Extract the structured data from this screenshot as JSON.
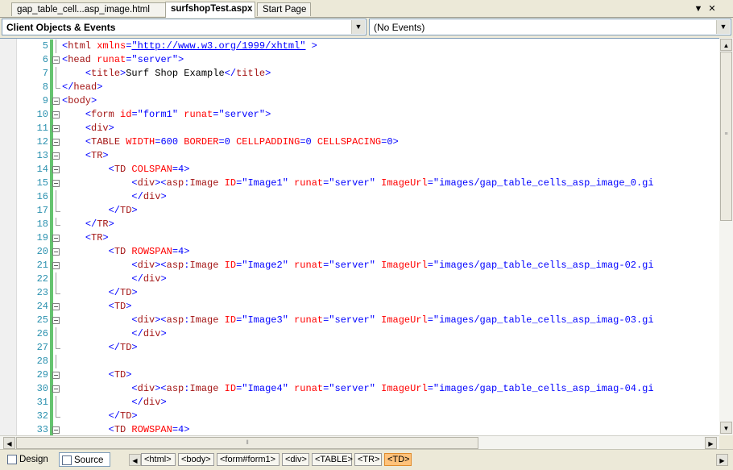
{
  "tabs": [
    {
      "label": "gap_table_cell...asp_image.html",
      "active": false
    },
    {
      "label": "surfshopTest.aspx",
      "active": true
    },
    {
      "label": "Start Page",
      "active": false
    }
  ],
  "tab_controls": {
    "dropdown": "▼",
    "close": "✕"
  },
  "toolbar": {
    "objects_combo": "Client Objects & Events",
    "events_combo": "(No Events)"
  },
  "code_lines": [
    {
      "n": "5",
      "fold": "",
      "tokens": [
        [
          "b",
          "<"
        ],
        [
          "r",
          "html "
        ],
        [
          "a",
          "xmlns"
        ],
        [
          "b",
          "="
        ],
        [
          "u",
          "\"http://www.w3.org/1999/xhtml\""
        ],
        [
          "b",
          " >"
        ]
      ]
    },
    {
      "n": "6",
      "fold": "-",
      "tokens": [
        [
          "b",
          "<"
        ],
        [
          "r",
          "head "
        ],
        [
          "a",
          "runat"
        ],
        [
          "b",
          "=\"server\">"
        ]
      ]
    },
    {
      "n": "7",
      "fold": "",
      "tokens": [
        [
          "x",
          "    "
        ],
        [
          "b",
          "<"
        ],
        [
          "r",
          "title"
        ],
        [
          "b",
          ">"
        ],
        [
          "x",
          "Surf Shop Example"
        ],
        [
          "b",
          "</"
        ],
        [
          "r",
          "title"
        ],
        [
          "b",
          ">"
        ]
      ]
    },
    {
      "n": "8",
      "fold": "e",
      "tokens": [
        [
          "b",
          "</"
        ],
        [
          "r",
          "head"
        ],
        [
          "b",
          ">"
        ]
      ]
    },
    {
      "n": "9",
      "fold": "-",
      "tokens": [
        [
          "b",
          "<"
        ],
        [
          "r",
          "body"
        ],
        [
          "b",
          ">"
        ]
      ]
    },
    {
      "n": "10",
      "fold": "-",
      "tokens": [
        [
          "x",
          "    "
        ],
        [
          "b",
          "<"
        ],
        [
          "r",
          "form "
        ],
        [
          "a",
          "id"
        ],
        [
          "b",
          "=\"form1\" "
        ],
        [
          "a",
          "runat"
        ],
        [
          "b",
          "=\"server\">"
        ]
      ]
    },
    {
      "n": "11",
      "fold": "-",
      "tokens": [
        [
          "x",
          "    "
        ],
        [
          "b",
          "<"
        ],
        [
          "r",
          "div"
        ],
        [
          "b",
          ">"
        ]
      ]
    },
    {
      "n": "12",
      "fold": "-",
      "tokens": [
        [
          "x",
          "    "
        ],
        [
          "b",
          "<"
        ],
        [
          "r",
          "TABLE "
        ],
        [
          "a",
          "WIDTH"
        ],
        [
          "b",
          "=600 "
        ],
        [
          "a",
          "BORDER"
        ],
        [
          "b",
          "=0 "
        ],
        [
          "a",
          "CELLPADDING"
        ],
        [
          "b",
          "=0 "
        ],
        [
          "a",
          "CELLSPACING"
        ],
        [
          "b",
          "=0>"
        ]
      ]
    },
    {
      "n": "13",
      "fold": "-",
      "tokens": [
        [
          "x",
          "    "
        ],
        [
          "b",
          "<"
        ],
        [
          "r",
          "TR"
        ],
        [
          "b",
          ">"
        ]
      ]
    },
    {
      "n": "14",
      "fold": "-",
      "tokens": [
        [
          "x",
          "        "
        ],
        [
          "b",
          "<"
        ],
        [
          "r",
          "TD "
        ],
        [
          "a",
          "COLSPAN"
        ],
        [
          "b",
          "=4>"
        ]
      ]
    },
    {
      "n": "15",
      "fold": "-",
      "tokens": [
        [
          "x",
          "            "
        ],
        [
          "b",
          "<"
        ],
        [
          "r",
          "div"
        ],
        [
          "b",
          "><"
        ],
        [
          "r",
          "asp"
        ],
        [
          "b",
          ":"
        ],
        [
          "r",
          "Image "
        ],
        [
          "a",
          "ID"
        ],
        [
          "b",
          "=\"Image1\" "
        ],
        [
          "a",
          "runat"
        ],
        [
          "b",
          "=\"server\" "
        ],
        [
          "a",
          "ImageUrl"
        ],
        [
          "b",
          "=\"images/gap_table_cells_asp_image_0.gi"
        ]
      ]
    },
    {
      "n": "16",
      "fold": "",
      "tokens": [
        [
          "x",
          "            "
        ],
        [
          "b",
          "</"
        ],
        [
          "r",
          "div"
        ],
        [
          "b",
          ">"
        ]
      ]
    },
    {
      "n": "17",
      "fold": "e",
      "tokens": [
        [
          "x",
          "        "
        ],
        [
          "b",
          "</"
        ],
        [
          "r",
          "TD"
        ],
        [
          "b",
          ">"
        ]
      ]
    },
    {
      "n": "18",
      "fold": "e",
      "tokens": [
        [
          "x",
          "    "
        ],
        [
          "b",
          "</"
        ],
        [
          "r",
          "TR"
        ],
        [
          "b",
          ">"
        ]
      ]
    },
    {
      "n": "19",
      "fold": "-",
      "tokens": [
        [
          "x",
          "    "
        ],
        [
          "b",
          "<"
        ],
        [
          "r",
          "TR"
        ],
        [
          "b",
          ">"
        ]
      ]
    },
    {
      "n": "20",
      "fold": "-",
      "tokens": [
        [
          "x",
          "        "
        ],
        [
          "b",
          "<"
        ],
        [
          "r",
          "TD "
        ],
        [
          "a",
          "ROWSPAN"
        ],
        [
          "b",
          "=4>"
        ]
      ]
    },
    {
      "n": "21",
      "fold": "-",
      "tokens": [
        [
          "x",
          "            "
        ],
        [
          "b",
          "<"
        ],
        [
          "r",
          "div"
        ],
        [
          "b",
          "><"
        ],
        [
          "r",
          "asp"
        ],
        [
          "b",
          ":"
        ],
        [
          "r",
          "Image "
        ],
        [
          "a",
          "ID"
        ],
        [
          "b",
          "=\"Image2\" "
        ],
        [
          "a",
          "runat"
        ],
        [
          "b",
          "=\"server\" "
        ],
        [
          "a",
          "ImageUrl"
        ],
        [
          "b",
          "=\"images/gap_table_cells_asp_imag-02.gi"
        ]
      ]
    },
    {
      "n": "22",
      "fold": "",
      "tokens": [
        [
          "x",
          "            "
        ],
        [
          "b",
          "</"
        ],
        [
          "r",
          "div"
        ],
        [
          "b",
          ">"
        ]
      ]
    },
    {
      "n": "23",
      "fold": "e",
      "tokens": [
        [
          "x",
          "        "
        ],
        [
          "b",
          "</"
        ],
        [
          "r",
          "TD"
        ],
        [
          "b",
          ">"
        ]
      ]
    },
    {
      "n": "24",
      "fold": "-",
      "tokens": [
        [
          "x",
          "        "
        ],
        [
          "b",
          "<"
        ],
        [
          "r",
          "TD"
        ],
        [
          "b",
          ">"
        ]
      ]
    },
    {
      "n": "25",
      "fold": "-",
      "tokens": [
        [
          "x",
          "            "
        ],
        [
          "b",
          "<"
        ],
        [
          "r",
          "div"
        ],
        [
          "b",
          "><"
        ],
        [
          "r",
          "asp"
        ],
        [
          "b",
          ":"
        ],
        [
          "r",
          "Image "
        ],
        [
          "a",
          "ID"
        ],
        [
          "b",
          "=\"Image3\" "
        ],
        [
          "a",
          "runat"
        ],
        [
          "b",
          "=\"server\" "
        ],
        [
          "a",
          "ImageUrl"
        ],
        [
          "b",
          "=\"images/gap_table_cells_asp_imag-03.gi"
        ]
      ]
    },
    {
      "n": "26",
      "fold": "",
      "tokens": [
        [
          "x",
          "            "
        ],
        [
          "b",
          "</"
        ],
        [
          "r",
          "div"
        ],
        [
          "b",
          ">"
        ]
      ]
    },
    {
      "n": "27",
      "fold": "e",
      "tokens": [
        [
          "x",
          "        "
        ],
        [
          "b",
          "</"
        ],
        [
          "r",
          "TD"
        ],
        [
          "b",
          ">"
        ]
      ]
    },
    {
      "n": "28",
      "fold": "",
      "tokens": []
    },
    {
      "n": "29",
      "fold": "-",
      "tokens": [
        [
          "x",
          "        "
        ],
        [
          "b",
          "<"
        ],
        [
          "r",
          "TD"
        ],
        [
          "b",
          ">"
        ]
      ]
    },
    {
      "n": "30",
      "fold": "-",
      "tokens": [
        [
          "x",
          "            "
        ],
        [
          "b",
          "<"
        ],
        [
          "r",
          "div"
        ],
        [
          "b",
          "><"
        ],
        [
          "r",
          "asp"
        ],
        [
          "b",
          ":"
        ],
        [
          "r",
          "Image "
        ],
        [
          "a",
          "ID"
        ],
        [
          "b",
          "=\"Image4\" "
        ],
        [
          "a",
          "runat"
        ],
        [
          "b",
          "=\"server\" "
        ],
        [
          "a",
          "ImageUrl"
        ],
        [
          "b",
          "=\"images/gap_table_cells_asp_imag-04.gi"
        ]
      ]
    },
    {
      "n": "31",
      "fold": "",
      "tokens": [
        [
          "x",
          "            "
        ],
        [
          "b",
          "</"
        ],
        [
          "r",
          "div"
        ],
        [
          "b",
          ">"
        ]
      ]
    },
    {
      "n": "32",
      "fold": "e",
      "tokens": [
        [
          "x",
          "        "
        ],
        [
          "b",
          "</"
        ],
        [
          "r",
          "TD"
        ],
        [
          "b",
          ">"
        ]
      ]
    },
    {
      "n": "33",
      "fold": "-",
      "tokens": [
        [
          "x",
          "        "
        ],
        [
          "b",
          "<"
        ],
        [
          "r",
          "TD "
        ],
        [
          "a",
          "ROWSPAN"
        ],
        [
          "b",
          "=4>"
        ]
      ]
    }
  ],
  "views": [
    {
      "label": "Design",
      "active": false
    },
    {
      "label": "Source",
      "active": true
    }
  ],
  "breadcrumbs": [
    "<html>",
    "<body>",
    "<form#form1>",
    "<div>",
    "<TABLE>",
    "<TR>",
    "<TD>"
  ],
  "colors": {
    "accent_crumb": "#ffc27a",
    "line_number": "#2b91af",
    "change_bar": "#65c36f"
  }
}
